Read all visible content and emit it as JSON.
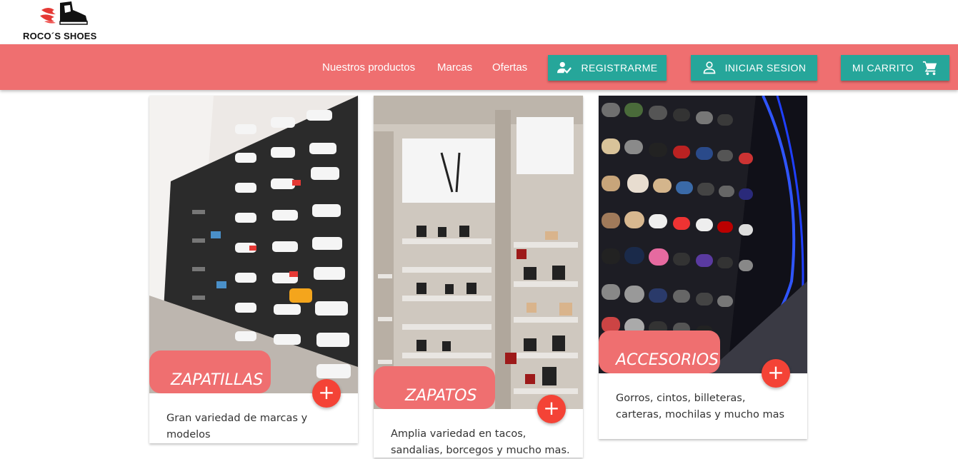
{
  "brand": {
    "name": "ROCO´S SHOES"
  },
  "nav": {
    "links": [
      "Nuestros productos",
      "Marcas",
      "Ofertas"
    ],
    "register_label": "REGISTRARME",
    "login_label": "INICIAR SESION",
    "cart_label": "MI CARRITO"
  },
  "cards": [
    {
      "title": "ZAPATILLAS",
      "description": "Gran variedad de marcas y modelos",
      "image": "sneaker-wall-photo",
      "action": "+"
    },
    {
      "title": "ZAPATOS",
      "description": "Amplia variedad en tacos, sandalias, borcegos y mucho mas.",
      "image": "heels-shelf-photo",
      "action": "+"
    },
    {
      "title": "ACCESORIOS",
      "description": "Gorros, cintos, billeteras, carteras, mochilas y mucho mas",
      "image": "caps-wall-photo",
      "action": "+"
    }
  ],
  "colors": {
    "navbar": "#ef6f70",
    "button": "#26a69a",
    "fab": "#f44336"
  }
}
